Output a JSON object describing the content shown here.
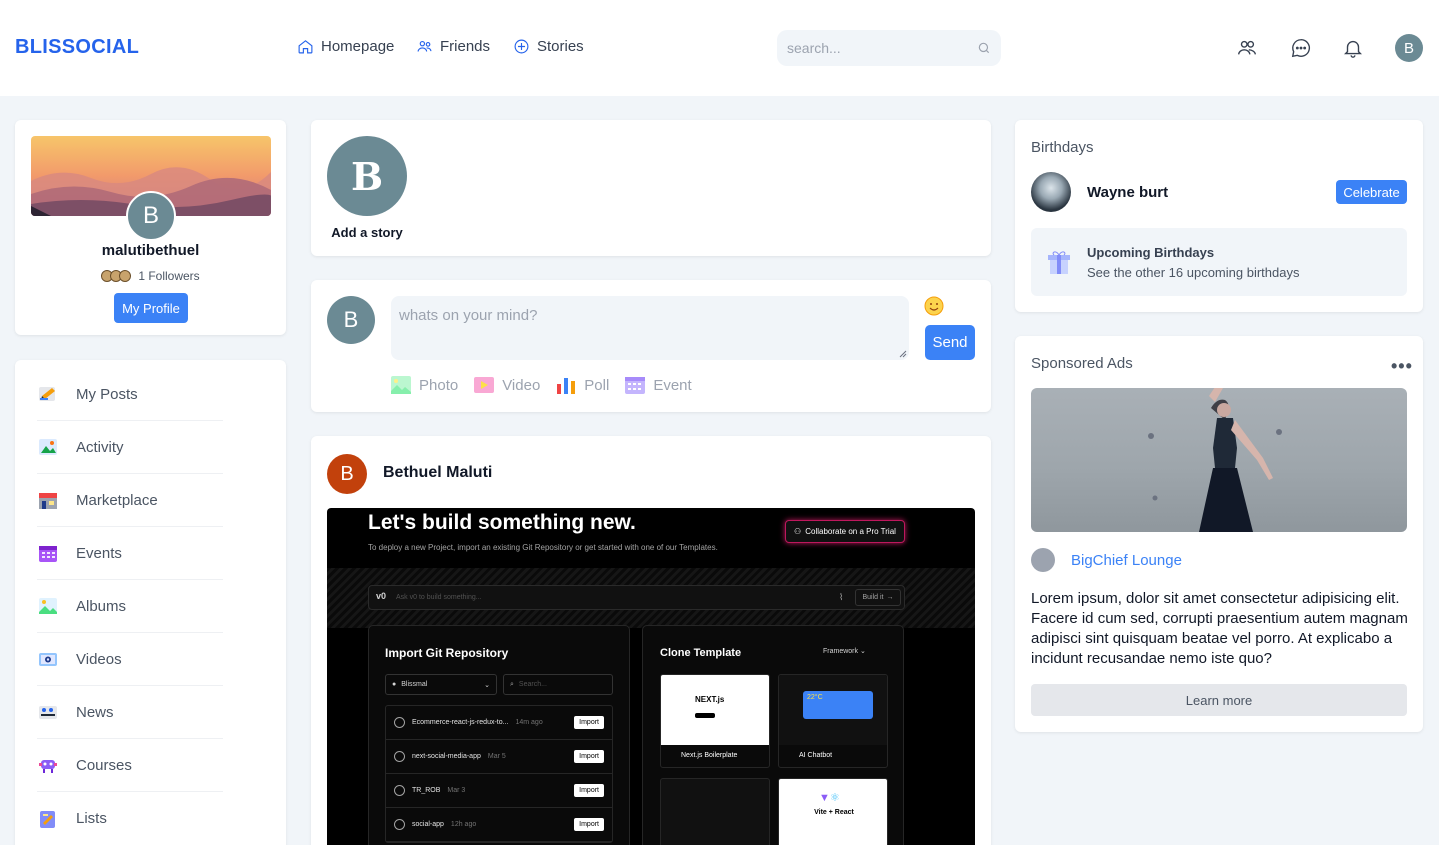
{
  "brand": "BLISSOCIAL",
  "nav": [
    {
      "label": "Homepage",
      "icon": "home-icon"
    },
    {
      "label": "Friends",
      "icon": "friends-icon"
    },
    {
      "label": "Stories",
      "icon": "plus-circle-icon"
    }
  ],
  "search": {
    "placeholder": "search..."
  },
  "header_icons": [
    "people-icon",
    "chat-icon",
    "bell-icon"
  ],
  "user_initial": "B",
  "profile": {
    "initial": "B",
    "username": "malutibethuel",
    "followers": "1 Followers",
    "button": "My Profile"
  },
  "menu": [
    {
      "label": "My Posts",
      "icon": "posts-icon"
    },
    {
      "label": "Activity",
      "icon": "activity-icon"
    },
    {
      "label": "Marketplace",
      "icon": "marketplace-icon"
    },
    {
      "label": "Events",
      "icon": "calendar-icon"
    },
    {
      "label": "Albums",
      "icon": "album-icon"
    },
    {
      "label": "Videos",
      "icon": "video-icon"
    },
    {
      "label": "News",
      "icon": "news-icon"
    },
    {
      "label": "Courses",
      "icon": "courses-icon"
    },
    {
      "label": "Lists",
      "icon": "lists-icon"
    }
  ],
  "stories": {
    "add_label": "Add a story",
    "initial": "B"
  },
  "composer": {
    "initial": "B",
    "placeholder": "whats on your mind?",
    "send": "Send",
    "options": [
      {
        "label": "Photo",
        "icon": "photo-icon"
      },
      {
        "label": "Video",
        "icon": "video-icon"
      },
      {
        "label": "Poll",
        "icon": "poll-icon"
      },
      {
        "label": "Event",
        "icon": "calendar-icon"
      }
    ]
  },
  "post": {
    "author_initial": "B",
    "author": "Bethuel Maluti",
    "screenshot": {
      "heading": "Let's build something new.",
      "sub": "To deploy a new Project, import an existing Git Repository or get started with one of our Templates.",
      "collab_btn": "Collaborate on a Pro Trial",
      "ask_placeholder": "Ask v0 to build something...",
      "build_btn": "Build it",
      "import_title": "Import Git Repository",
      "account": "Blissmal",
      "search_placeholder": "Search...",
      "repos": [
        {
          "name": "Ecommerce-react-js-redux-to...",
          "date": "14m ago"
        },
        {
          "name": "next-social-media-app",
          "date": "Mar 5"
        },
        {
          "name": "TR_ROB",
          "date": "Mar 3"
        },
        {
          "name": "social-app",
          "date": "12h ago"
        }
      ],
      "import_btn": "Import",
      "clone_title": "Clone Template",
      "framework": "Framework",
      "templates": [
        {
          "name": "Next.js Boilerplate"
        },
        {
          "name": "AI Chatbot"
        },
        {
          "name": ""
        },
        {
          "name": "Vite + React"
        }
      ],
      "weather": "22°C"
    }
  },
  "birthdays": {
    "title": "Birthdays",
    "name": "Wayne burt",
    "button": "Celebrate",
    "upcoming_title": "Upcoming Birthdays",
    "upcoming_sub": "See the other 16 upcoming birthdays"
  },
  "ads": {
    "title": "Sponsored Ads",
    "brand": "BigChief Lounge",
    "text": "Lorem ipsum, dolor sit amet consectetur adipisicing elit. Facere id cum sed, corrupti praesentium autem magnam adipisci sint quisquam beatae vel porro. At explicabo a incidunt recusandae nemo iste quo?",
    "button": "Learn more"
  },
  "colors": {
    "accent": "#3b82f6",
    "brand": "#2563eb",
    "page_bg": "#f1f5f9"
  }
}
